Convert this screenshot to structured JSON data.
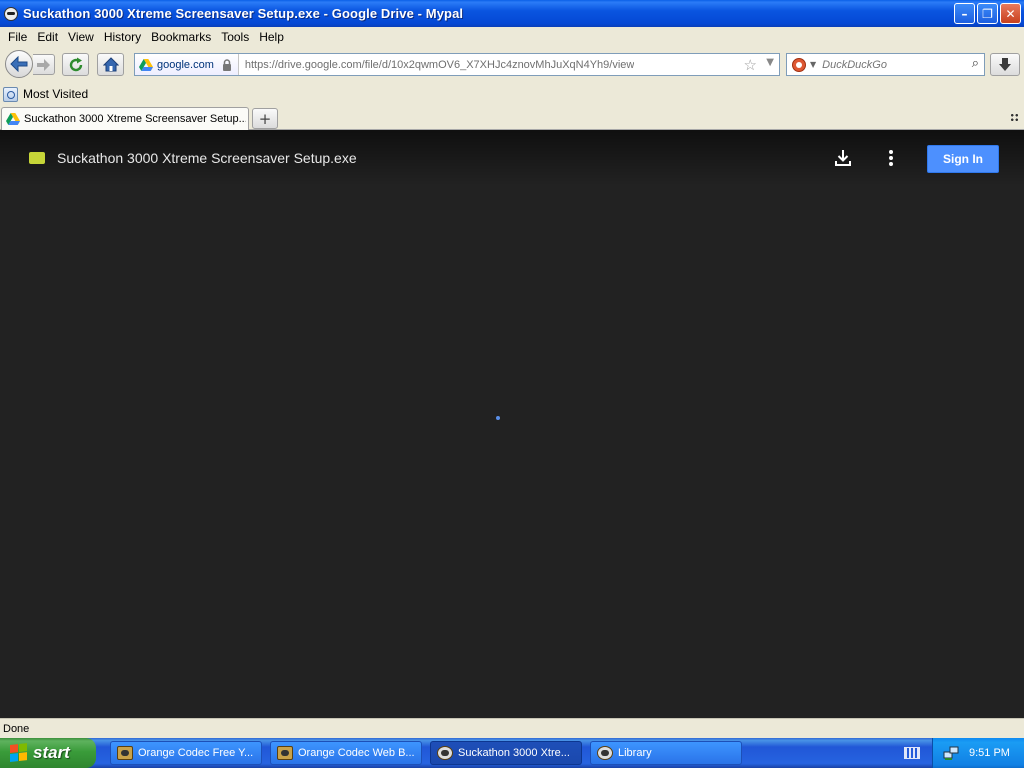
{
  "window": {
    "title": "Suckathon 3000 Xtreme Screensaver Setup.exe - Google Drive - Mypal",
    "minimize": "–",
    "restore": "❐",
    "close": "✕"
  },
  "menu": [
    "File",
    "Edit",
    "View",
    "History",
    "Bookmarks",
    "Tools",
    "Help"
  ],
  "navbar": {
    "identity_domain": "google.com",
    "url": "https://drive.google.com/file/d/10x2qwmOV6_X7XHJc4znovMhJuXqN4Yh9/view",
    "search_placeholder": "DuckDuckGo"
  },
  "bookmarks": {
    "most_visited": "Most Visited"
  },
  "tabs": [
    {
      "label": "Suckathon 3000 Xtreme Screensaver Setup...."
    }
  ],
  "viewer": {
    "file_name": "Suckathon 3000 Xtreme Screensaver Setup.exe",
    "sign_in": "Sign In"
  },
  "status": {
    "text": "Done"
  },
  "taskbar": {
    "start": "start",
    "items": [
      {
        "label": "Orange Codec Free Y..."
      },
      {
        "label": "Orange Codec Web B..."
      },
      {
        "label": "Suckathon 3000 Xtre..."
      },
      {
        "label": "Library"
      }
    ],
    "clock": "9:51 PM"
  },
  "colors": {
    "viewer_bg": "#222222",
    "sign_in_blue": "#4d90fe",
    "file_icon": "#c6d538",
    "titlebar_blue": "#0548d4"
  }
}
